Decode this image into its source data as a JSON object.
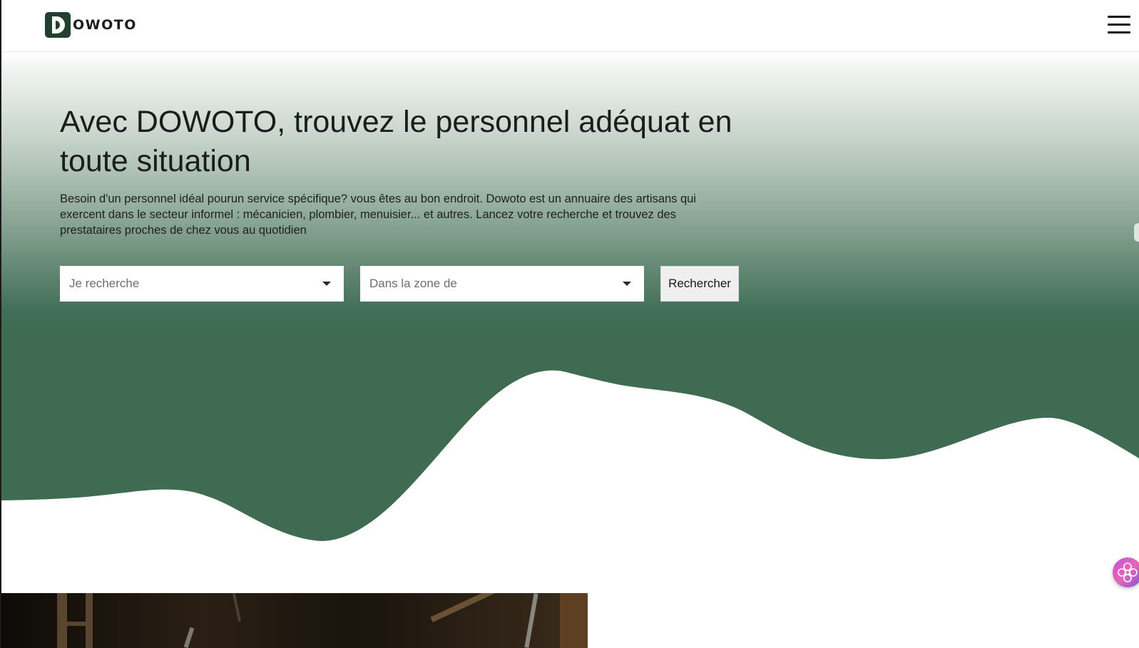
{
  "navbar": {
    "logo_text": "OWOTO",
    "menu_icon": "hamburger-icon"
  },
  "hero": {
    "title": "Avec DOWOTO, trouvez le personnel adéquat en toute situation",
    "description": "Besoin d'un personnel idéal pourun service spécifique? vous êtes au bon endroit. Dowoto est un annuaire des artisans qui exercent dans le secteur informel : mécanicien, plombier, menuisier... et autres. Lancez votre recherche et trouvez des prestataires proches de chez vous au quotidien",
    "search": {
      "service_placeholder": "Je recherche",
      "zone_placeholder": "Dans la zone de",
      "button_label": "Rechercher"
    }
  },
  "colors": {
    "brand_green": "#3f6b53",
    "logo_green": "#22402f",
    "assistant_pink": "#d85bc7"
  },
  "assistant": {
    "icon": "flower-chat-icon"
  }
}
